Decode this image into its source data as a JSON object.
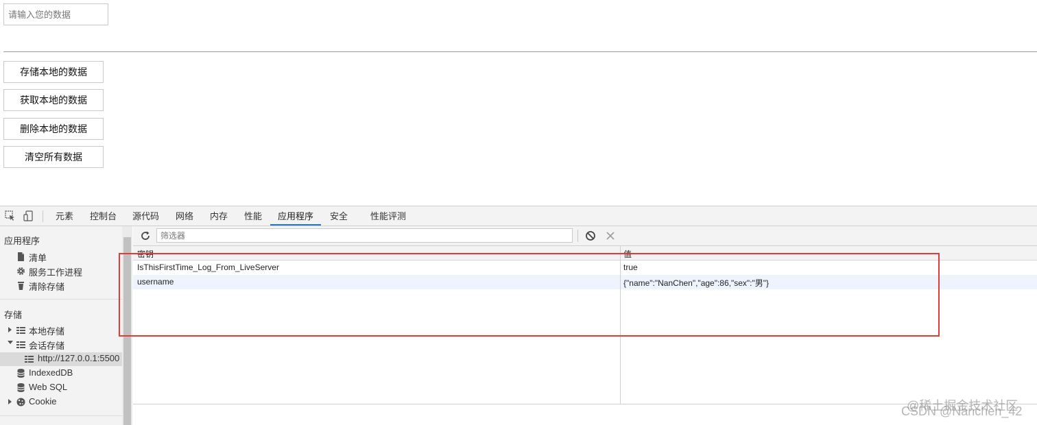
{
  "page": {
    "input_placeholder": "请输入您的数据",
    "buttons": {
      "save": "存储本地的数据",
      "get": "获取本地的数据",
      "remove": "删除本地的数据",
      "clear": "清空所有数据"
    }
  },
  "devtools": {
    "tabs": [
      "元素",
      "控制台",
      "源代码",
      "网络",
      "内存",
      "性能",
      "应用程序",
      "安全",
      "性能评测"
    ],
    "active_tab": "应用程序",
    "sidebar": {
      "app_heading": "应用程序",
      "app_items": [
        "清单",
        "服务工作进程",
        "清除存储"
      ],
      "storage_heading": "存储",
      "local_storage": "本地存储",
      "session_storage": "会话存储",
      "session_origin": "http://127.0.0.1:5500",
      "indexeddb": "IndexedDB",
      "websql": "Web SQL",
      "cookie": "Cookie"
    },
    "toolbar": {
      "filter_placeholder": "筛选器"
    },
    "table": {
      "headers": {
        "key": "密钥",
        "value": "值"
      },
      "rows": [
        {
          "key": "IsThisFirstTime_Log_From_LiveServer",
          "value": "true"
        },
        {
          "key": "username",
          "value": "{\"name\":\"NanChen\",\"age\":86,\"sex\":\"男\"}"
        }
      ]
    }
  },
  "watermark": {
    "line1": "@稀土掘金技术社区",
    "line2": "CSDN @Nanchen_42"
  },
  "colors": {
    "highlight_border": "#e53935",
    "active_tab_underline": "#1a73e8",
    "row_alt": "#eef4fd"
  }
}
